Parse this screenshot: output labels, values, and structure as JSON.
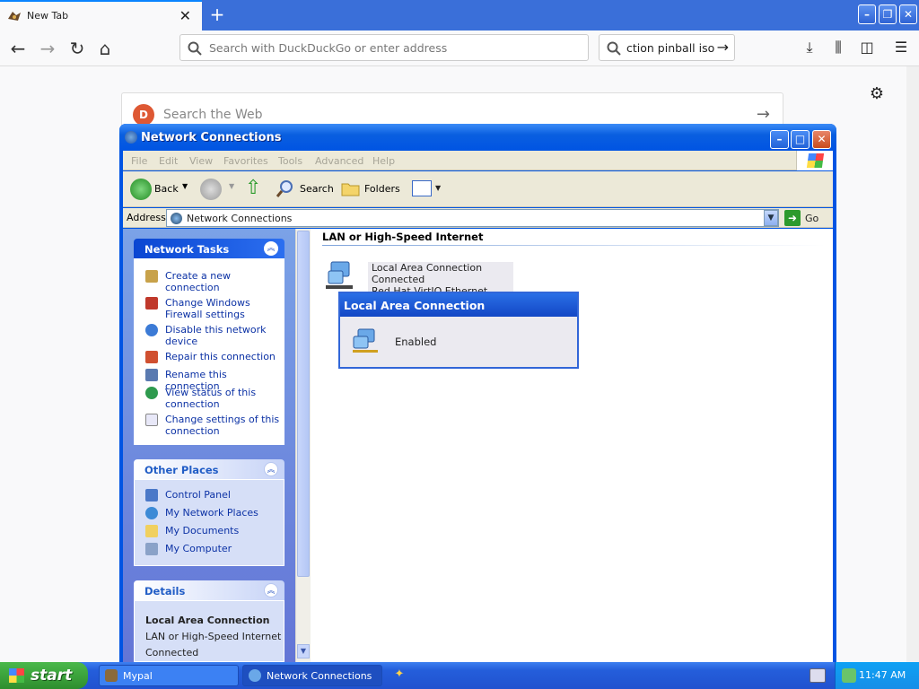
{
  "browser": {
    "tab_title": "New Tab",
    "tab_close": "✕",
    "new_tab": "+",
    "url_placeholder": "Search with DuckDuckGo or enter address",
    "search_value": "ction pinball iso",
    "ddg_placeholder": "Search the Web"
  },
  "window": {
    "title": "Network Connections",
    "menu": [
      "File",
      "Edit",
      "View",
      "Favorites",
      "Tools",
      "Advanced",
      "Help"
    ],
    "toolbar": {
      "back": "Back",
      "search": "Search",
      "folders": "Folders"
    },
    "address_label": "Address",
    "address_value": "Network Connections",
    "go_label": "Go"
  },
  "network_tasks": {
    "title": "Network Tasks",
    "items": [
      "Create a new connection",
      "Change Windows Firewall settings",
      "Disable this network device",
      "Repair this connection",
      "Rename this connection",
      "View status of this connection",
      "Change settings of this connection"
    ]
  },
  "other_places": {
    "title": "Other Places",
    "items": [
      "Control Panel",
      "My Network Places",
      "My Documents",
      "My Computer"
    ]
  },
  "details": {
    "title": "Details",
    "name": "Local Area Connection",
    "type": "LAN or High-Speed Internet",
    "status": "Connected"
  },
  "content": {
    "group_header": "LAN or High-Speed Internet",
    "connection": {
      "name": "Local Area Connection",
      "status": "Connected",
      "device": "Red Hat VirtIO Ethernet Adapter"
    }
  },
  "tooltip": {
    "title": "Local Area Connection",
    "value": "Enabled"
  },
  "taskbar": {
    "start": "start",
    "tasks": [
      "Mypal",
      "Network Connections"
    ],
    "clock": "11:47 AM"
  }
}
